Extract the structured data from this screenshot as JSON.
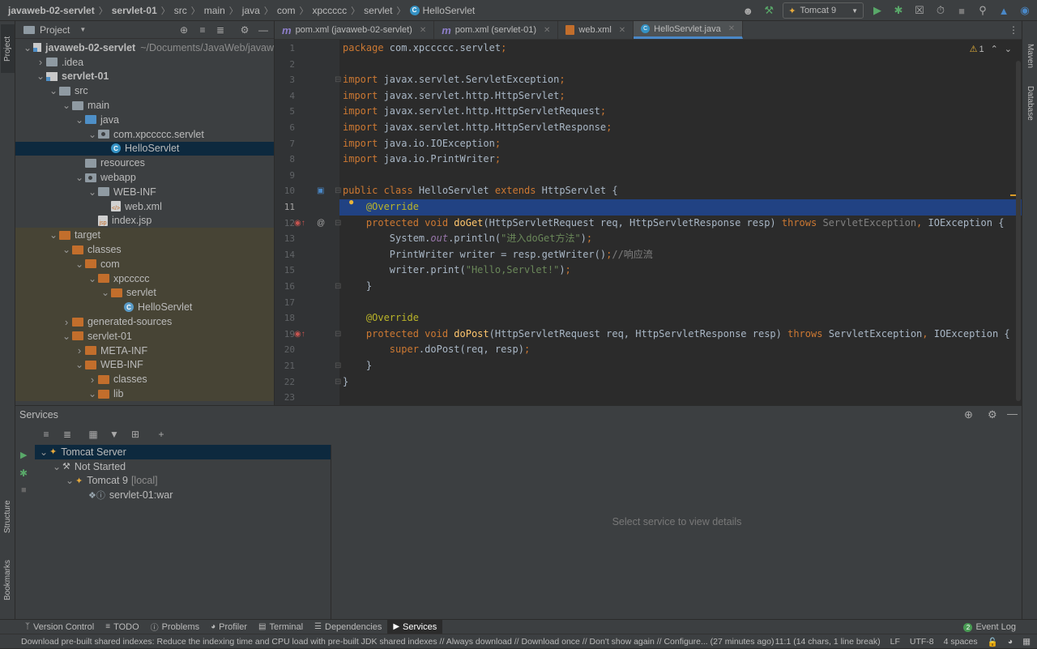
{
  "breadcrumbs": [
    "javaweb-02-servlet",
    "servlet-01",
    "src",
    "main",
    "java",
    "com",
    "xpccccc",
    "servlet",
    "HelloServlet"
  ],
  "run_config": "Tomcat 9",
  "project_panel": {
    "title": "Project",
    "tree": [
      {
        "label": "javaweb-02-servlet",
        "extra": "~/Documents/JavaWeb/javaw",
        "indent": 0,
        "arrow": "down",
        "icon": "module",
        "bold": true
      },
      {
        "label": ".idea",
        "indent": 1,
        "arrow": "right",
        "icon": "folder-gray"
      },
      {
        "label": "servlet-01",
        "indent": 1,
        "arrow": "down",
        "icon": "module",
        "bold": true
      },
      {
        "label": "src",
        "indent": 2,
        "arrow": "down",
        "icon": "folder-gray"
      },
      {
        "label": "main",
        "indent": 3,
        "arrow": "down",
        "icon": "folder-gray"
      },
      {
        "label": "java",
        "indent": 4,
        "arrow": "down",
        "icon": "folder-blue"
      },
      {
        "label": "com.xpccccc.servlet",
        "indent": 5,
        "arrow": "down",
        "icon": "package"
      },
      {
        "label": "HelloServlet",
        "indent": 6,
        "arrow": "",
        "icon": "class",
        "selected": true
      },
      {
        "label": "resources",
        "indent": 4,
        "arrow": "",
        "icon": "folder-res"
      },
      {
        "label": "webapp",
        "indent": 4,
        "arrow": "down",
        "icon": "folder-web"
      },
      {
        "label": "WEB-INF",
        "indent": 5,
        "arrow": "down",
        "icon": "folder-gray"
      },
      {
        "label": "web.xml",
        "indent": 6,
        "arrow": "",
        "icon": "xml"
      },
      {
        "label": "index.jsp",
        "indent": 5,
        "arrow": "",
        "icon": "jsp"
      },
      {
        "label": "target",
        "indent": 2,
        "arrow": "down",
        "icon": "folder-orange",
        "target": true
      },
      {
        "label": "classes",
        "indent": 3,
        "arrow": "down",
        "icon": "folder-orange",
        "target": true
      },
      {
        "label": "com",
        "indent": 4,
        "arrow": "down",
        "icon": "folder-orange",
        "target": true
      },
      {
        "label": "xpccccc",
        "indent": 5,
        "arrow": "down",
        "icon": "folder-orange",
        "target": true
      },
      {
        "label": "servlet",
        "indent": 6,
        "arrow": "down",
        "icon": "folder-orange",
        "target": true
      },
      {
        "label": "HelloServlet",
        "indent": 7,
        "arrow": "",
        "icon": "class-compiled",
        "target": true
      },
      {
        "label": "generated-sources",
        "indent": 3,
        "arrow": "right",
        "icon": "folder-orange",
        "target": true
      },
      {
        "label": "servlet-01",
        "indent": 3,
        "arrow": "down",
        "icon": "folder-orange",
        "target": true
      },
      {
        "label": "META-INF",
        "indent": 4,
        "arrow": "right",
        "icon": "folder-orange",
        "target": true
      },
      {
        "label": "WEB-INF",
        "indent": 4,
        "arrow": "down",
        "icon": "folder-orange",
        "target": true
      },
      {
        "label": "classes",
        "indent": 5,
        "arrow": "right",
        "icon": "folder-orange",
        "target": true
      },
      {
        "label": "lib",
        "indent": 5,
        "arrow": "down",
        "icon": "folder-orange",
        "target": true
      }
    ]
  },
  "tabs": [
    {
      "label": "pom.xml (javaweb-02-servlet)",
      "icon": "maven-icon"
    },
    {
      "label": "pom.xml (servlet-01)",
      "icon": "maven-icon"
    },
    {
      "label": "web.xml",
      "icon": "xml-icon"
    },
    {
      "label": "HelloServlet.java",
      "icon": "class-icon",
      "active": true
    }
  ],
  "editor": {
    "warning_count": "1",
    "current_line": 11,
    "lines": [
      [
        [
          "kw",
          "package "
        ],
        [
          "",
          "com.xpccccc.servlet"
        ],
        [
          "kw",
          ";"
        ]
      ],
      [],
      [
        [
          "kw",
          "import "
        ],
        [
          "",
          "javax.servlet.ServletException"
        ],
        [
          "kw",
          ";"
        ]
      ],
      [
        [
          "kw",
          "import "
        ],
        [
          "",
          "javax.servlet.http.HttpServlet"
        ],
        [
          "kw",
          ";"
        ]
      ],
      [
        [
          "kw",
          "import "
        ],
        [
          "",
          "javax.servlet.http.HttpServletRequest"
        ],
        [
          "kw",
          ";"
        ]
      ],
      [
        [
          "kw",
          "import "
        ],
        [
          "",
          "javax.servlet.http.HttpServletResponse"
        ],
        [
          "kw",
          ";"
        ]
      ],
      [
        [
          "kw",
          "import "
        ],
        [
          "",
          "java.io.IOException"
        ],
        [
          "kw",
          ";"
        ]
      ],
      [
        [
          "kw",
          "import "
        ],
        [
          "",
          "java.io.PrintWriter"
        ],
        [
          "kw",
          ";"
        ]
      ],
      [],
      [
        [
          "kw",
          "public class "
        ],
        [
          "",
          "HelloServlet "
        ],
        [
          "kw",
          "extends "
        ],
        [
          "",
          "HttpServlet {"
        ]
      ],
      [
        [
          "",
          "    "
        ],
        [
          "an",
          "@Override"
        ]
      ],
      [
        [
          "",
          "    "
        ],
        [
          "kw",
          "protected void "
        ],
        [
          "fn",
          "doGet"
        ],
        [
          "",
          "(HttpServletRequest req, HttpServletResponse resp) "
        ],
        [
          "kw",
          "throws "
        ],
        [
          "gy",
          "ServletException"
        ],
        [
          "kw",
          ", "
        ],
        [
          "",
          "IOException {"
        ]
      ],
      [
        [
          "",
          "        System."
        ],
        [
          "it",
          "out"
        ],
        [
          "",
          ".println("
        ],
        [
          "st",
          "\"进入doGet方法\""
        ],
        [
          "",
          ")"
        ],
        [
          "kw",
          ";"
        ]
      ],
      [
        [
          "",
          "        PrintWriter writer = resp.getWriter()"
        ],
        [
          "kw",
          ";"
        ],
        [
          "cm",
          "//响应流"
        ]
      ],
      [
        [
          "",
          "        writer.print("
        ],
        [
          "st",
          "\"Hello,Servlet!\""
        ],
        [
          "",
          ")"
        ],
        [
          "kw",
          ";"
        ]
      ],
      [
        [
          "",
          "    }"
        ]
      ],
      [],
      [
        [
          "",
          "    "
        ],
        [
          "an",
          "@Override"
        ]
      ],
      [
        [
          "",
          "    "
        ],
        [
          "kw",
          "protected void "
        ],
        [
          "fn",
          "doPost"
        ],
        [
          "",
          "(HttpServletRequest req, HttpServletResponse resp) "
        ],
        [
          "kw",
          "throws "
        ],
        [
          "",
          "ServletException"
        ],
        [
          "kw",
          ", "
        ],
        [
          "",
          "IOException {"
        ]
      ],
      [
        [
          "",
          "        "
        ],
        [
          "kw",
          "super"
        ],
        [
          "",
          ".doPost(req, resp)"
        ],
        [
          "kw",
          ";"
        ]
      ],
      [
        [
          "",
          "    }"
        ]
      ],
      [
        [
          "",
          "}"
        ]
      ],
      []
    ]
  },
  "services": {
    "title": "Services",
    "tree": [
      {
        "label": "Tomcat Server",
        "indent": 0,
        "arrow": "down",
        "selected": true
      },
      {
        "label": "Not Started",
        "indent": 1,
        "arrow": "down"
      },
      {
        "label": "Tomcat 9",
        "suffix": "[local]",
        "indent": 2,
        "arrow": "down"
      },
      {
        "label": "servlet-01:war",
        "indent": 3,
        "arrow": ""
      }
    ],
    "placeholder": "Select service to view details"
  },
  "left_strip": {
    "project": "Project",
    "structure": "Structure",
    "bookmarks": "Bookmarks"
  },
  "right_strip": {
    "maven": "Maven",
    "database": "Database"
  },
  "bottom_tabs": [
    {
      "label": "Version Control",
      "icon": "branch-icon"
    },
    {
      "label": "TODO",
      "icon": "list-icon"
    },
    {
      "label": "Problems",
      "icon": "problems-icon"
    },
    {
      "label": "Profiler",
      "icon": "profiler-icon"
    },
    {
      "label": "Terminal",
      "icon": "terminal-icon"
    },
    {
      "label": "Dependencies",
      "icon": "dependencies-icon"
    },
    {
      "label": "Services",
      "icon": "services-icon",
      "active": true
    }
  ],
  "event_log": {
    "count": "2",
    "label": "Event Log"
  },
  "status": {
    "message": "Download pre-built shared indexes: Reduce the indexing time and CPU load with pre-built JDK shared indexes // Always download // Download once // Don't show again // Configure... (27 minutes ago)",
    "position": "11:1 (14 chars, 1 line break)",
    "line_sep": "LF",
    "encoding": "UTF-8",
    "indent": "4 spaces"
  },
  "colors": {
    "accent": "#4a88c7",
    "selection": "#0d293e",
    "current_line": "#214283",
    "keyword": "#cc7832",
    "annotation": "#bbb529",
    "string": "#6a8759"
  }
}
